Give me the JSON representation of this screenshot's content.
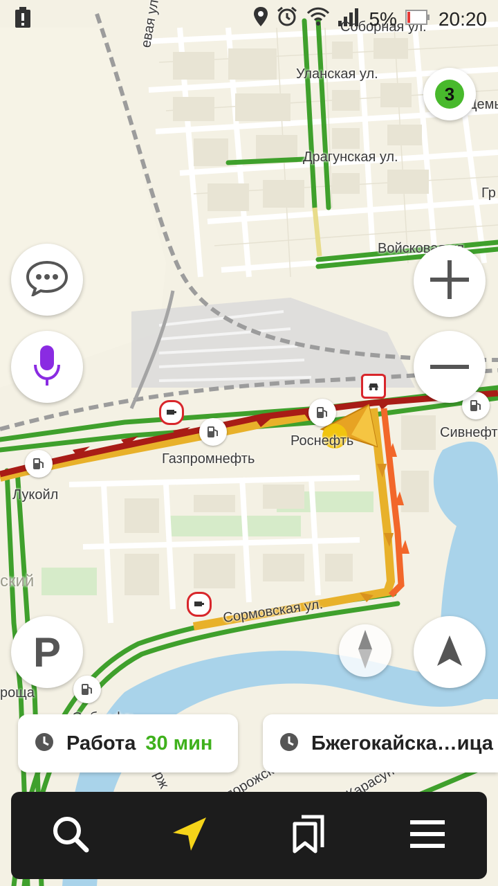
{
  "status_bar": {
    "battery_percent": "5%",
    "time": "20:20"
  },
  "map": {
    "streets": {
      "sobornaya": "Соборная ул.",
      "ulanskaya": "Уланская ул.",
      "dragunskaya": "Драгунская ул.",
      "voyskovaya": "Войсковая ул.",
      "sormovskaya": "Сормовская ул.",
      "dzerzh": "Дзерж",
      "zaporozhskaya": "Запорожская",
      "karasunskaya": "Карасунская"
    },
    "places": {
      "gazpromneft": "Газпромнефть",
      "lukoil": "Лукойл",
      "rosneft": "Роснефть",
      "sibneft_right": "Сивнефть",
      "sibneft_left": "Сибнефть",
      "district": "ский",
      "grove": "роща",
      "demyan": "Демь",
      "gr": "Гр",
      "street_left_top": "евая ул."
    }
  },
  "traffic_level": "3",
  "controls": {
    "zoom_in": "+",
    "zoom_out": "−",
    "parking": "P"
  },
  "bookmarks": [
    {
      "label": "Работа",
      "eta": "30 мин"
    },
    {
      "label": "Бжегокайска…ица",
      "eta": ""
    }
  ],
  "colors": {
    "route_red": "#a81c16",
    "route_orange": "#f2672a",
    "route_yellow": "#e8b12a",
    "road_green": "#3fa02c",
    "water": "#a9d3ea",
    "voice_purple": "#8a2be2"
  }
}
